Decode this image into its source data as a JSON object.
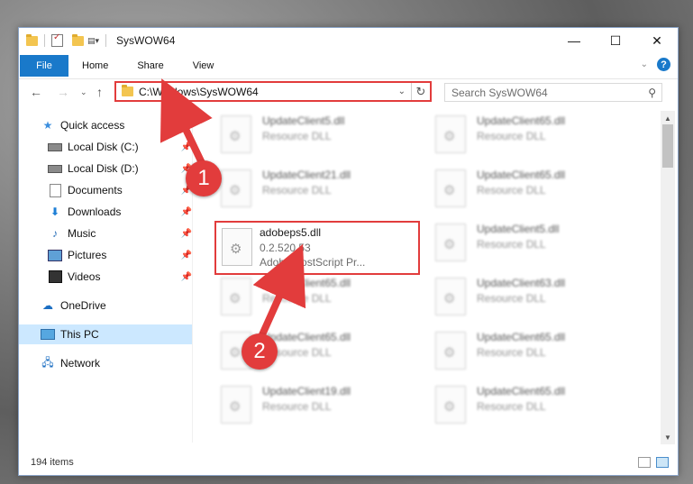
{
  "window": {
    "title": "SysWOW64",
    "controls": {
      "minimize": "—",
      "maximize": "☐",
      "close": "✕"
    }
  },
  "ribbon": {
    "tabs": [
      "File",
      "Home",
      "Share",
      "View"
    ],
    "help": "?"
  },
  "address": {
    "path": "C:\\Windows\\SysWOW64",
    "search_placeholder": "Search SysWOW64"
  },
  "nav": {
    "items": [
      {
        "label": "Quick access",
        "icon": "star-icon",
        "pinned": false
      },
      {
        "label": "Local Disk (C:)",
        "icon": "drive-icon",
        "pinned": true
      },
      {
        "label": "Local Disk (D:)",
        "icon": "drive-icon",
        "pinned": true
      },
      {
        "label": "Documents",
        "icon": "documents-icon",
        "pinned": true
      },
      {
        "label": "Downloads",
        "icon": "download-icon",
        "pinned": true
      },
      {
        "label": "Music",
        "icon": "music-icon",
        "pinned": true
      },
      {
        "label": "Pictures",
        "icon": "pictures-icon",
        "pinned": true
      },
      {
        "label": "Videos",
        "icon": "videos-icon",
        "pinned": true
      },
      {
        "label": "OneDrive",
        "icon": "cloud-icon",
        "pinned": false
      },
      {
        "label": "This PC",
        "icon": "computer-icon",
        "pinned": false,
        "selected": true
      },
      {
        "label": "Network",
        "icon": "network-icon",
        "pinned": false
      }
    ]
  },
  "files": {
    "left": [
      {
        "name": "UpdateClient5.dll",
        "line1": "Resource DLL",
        "line2": ""
      },
      {
        "name": "UpdateClient21.dll",
        "line1": "Resource DLL",
        "line2": ""
      },
      {
        "name": "adobeps5.dll",
        "line1": "0.2.520.53",
        "line2": "Adobe PostScript Pr...",
        "highlighted": true
      },
      {
        "name": "UpdateClient65.dll",
        "line1": "Resource DLL",
        "line2": ""
      },
      {
        "name": "UpdateClient65.dll",
        "line1": "Resource DLL",
        "line2": ""
      },
      {
        "name": "UpdateClient19.dll",
        "line1": "Resource DLL",
        "line2": ""
      }
    ],
    "right": [
      {
        "name": "UpdateClient65.dll",
        "line1": "Resource DLL"
      },
      {
        "name": "UpdateClient65.dll",
        "line1": "Resource DLL"
      },
      {
        "name": "UpdateClient5.dll",
        "line1": "Resource DLL"
      },
      {
        "name": "UpdateClient63.dll",
        "line1": "Resource DLL"
      },
      {
        "name": "UpdateClient65.dll",
        "line1": "Resource DLL"
      },
      {
        "name": "UpdateClient65.dll",
        "line1": "Resource DLL"
      }
    ]
  },
  "status": {
    "items": "194 items"
  },
  "callouts": [
    "1",
    "2"
  ],
  "colors": {
    "accent": "#1979ca",
    "highlight": "#e23c3c",
    "selection": "#cce8ff"
  }
}
